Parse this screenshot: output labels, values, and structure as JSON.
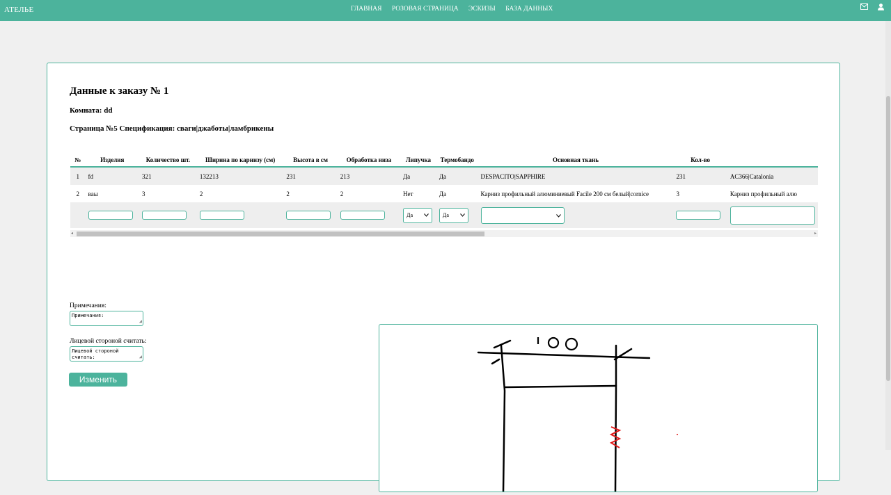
{
  "app": {
    "brand": "АТЕЛЬЕ",
    "nav": [
      "ГЛАВНАЯ",
      "РОЗОВАЯ СТРАНИЦА",
      "ЭСКИЗЫ",
      "БАЗА ДАННЫХ"
    ],
    "icons": [
      "envelope-icon",
      "user-icon"
    ],
    "accent_color": "#4cb39c"
  },
  "order": {
    "title": "Данные к заказу № 1",
    "room": "Комната: dd",
    "page": "Страница №5 Спецификация: сваги|джаботы|ламбрикены"
  },
  "table": {
    "headers": [
      "№",
      "Изделия",
      "Количество шт.",
      "Ширина по карнизу (см)",
      "Высота в см",
      "Обработка низа",
      "Липучка",
      "Термобандо",
      "Основная ткань",
      "Кол-во",
      ""
    ],
    "rows": [
      [
        "1",
        "fd",
        "321",
        "132213",
        "231",
        "213",
        "Да",
        "Да",
        "DESPACITO|SAPPHIRE",
        "231",
        "AC366|Catalonia"
      ],
      [
        "2",
        "вaы",
        "3",
        "2",
        "2",
        "2",
        "Нет",
        "Да",
        "Карниз профильный алюминиевый Facile 200 см белый|cornice",
        "3",
        "Карниз профильный алю"
      ]
    ],
    "new_row": {
      "lipuchka": "Да",
      "termobando": "Да"
    }
  },
  "form": {
    "notes_label": "Примечания:",
    "notes_placeholder": "Примечания:",
    "face_label": "Лицевой стороной считать:",
    "face_placeholder": "Лицевой стороной считать:",
    "submit": "Изменить"
  },
  "sketch": {
    "number": "100"
  }
}
